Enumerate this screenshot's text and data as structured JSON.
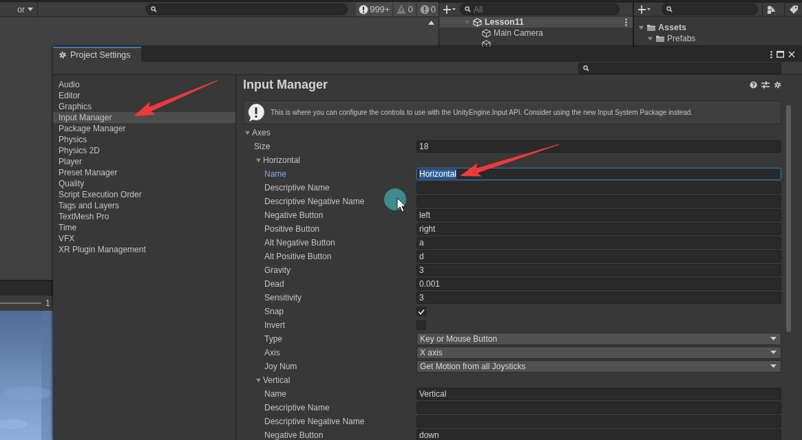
{
  "console_toolbar": {
    "dropdown": "or",
    "counts": [
      {
        "kind": "log",
        "value": "999+"
      },
      {
        "kind": "warning",
        "value": "0"
      },
      {
        "kind": "error",
        "value": "0"
      }
    ]
  },
  "game_view": {
    "scale": "1"
  },
  "hierarchy": {
    "search_placeholder": "All",
    "scene": "Lesson11",
    "objects": [
      "Main Camera"
    ]
  },
  "project": {
    "folders": [
      {
        "name": "Assets",
        "expanded": true,
        "children": [
          {
            "name": "Prefabs",
            "expanded": true
          }
        ]
      }
    ]
  },
  "window": {
    "title": "Project Settings",
    "sidebar": {
      "items": [
        {
          "label": "Audio",
          "selected": false
        },
        {
          "label": "Editor",
          "selected": false
        },
        {
          "label": "Graphics",
          "selected": false
        },
        {
          "label": "Input Manager",
          "selected": true
        },
        {
          "label": "Package Manager",
          "selected": false
        },
        {
          "label": "Physics",
          "selected": false
        },
        {
          "label": "Physics 2D",
          "selected": false
        },
        {
          "label": "Player",
          "selected": false
        },
        {
          "label": "Preset Manager",
          "selected": false
        },
        {
          "label": "Quality",
          "selected": false
        },
        {
          "label": "Script Execution Order",
          "selected": false
        },
        {
          "label": "Tags and Layers",
          "selected": false
        },
        {
          "label": "TextMesh Pro",
          "selected": false
        },
        {
          "label": "Time",
          "selected": false
        },
        {
          "label": "VFX",
          "selected": false
        },
        {
          "label": "XR Plugin Management",
          "selected": false
        }
      ]
    },
    "page_title": "Input Manager",
    "info": "This is where you can configure the controls to use with the UnityEngine.Input API. Consider using the new Input System Package instead.",
    "axes": {
      "label": "Axes",
      "expanded": true,
      "size_label": "Size",
      "size": "18",
      "children": [
        {
          "label": "Horizontal",
          "expanded": true,
          "properties": [
            {
              "label": "Name",
              "kind": "text",
              "value": "Horizontal",
              "focused": true
            },
            {
              "label": "Descriptive Name",
              "kind": "text",
              "focused": false
            },
            {
              "label": "Descriptive Negative Name",
              "kind": "text",
              "focused": false
            },
            {
              "label": "Negative Button",
              "kind": "text",
              "value": "left",
              "focused": false
            },
            {
              "label": "Positive Button",
              "kind": "text",
              "value": "right",
              "focused": false
            },
            {
              "label": "Alt Negative Button",
              "kind": "text",
              "value": "a",
              "focused": false
            },
            {
              "label": "Alt Positive Button",
              "kind": "text",
              "value": "d",
              "focused": false
            },
            {
              "label": "Gravity",
              "kind": "text",
              "value": "3",
              "focused": false
            },
            {
              "label": "Dead",
              "kind": "text",
              "value": "0.001",
              "focused": false
            },
            {
              "label": "Sensitivity",
              "kind": "text",
              "value": "3",
              "focused": false
            },
            {
              "label": "Snap",
              "kind": "checkbox",
              "checked": true
            },
            {
              "label": "Invert",
              "kind": "checkbox",
              "checked": false
            },
            {
              "label": "Type",
              "kind": "dropdown",
              "value": "Key or Mouse Button"
            },
            {
              "label": "Axis",
              "kind": "dropdown",
              "value": "X axis"
            },
            {
              "label": "Joy Num",
              "kind": "dropdown",
              "value": "Get Motion from all Joysticks"
            }
          ]
        },
        {
          "label": "Vertical",
          "expanded": true,
          "properties": [
            {
              "label": "Name",
              "kind": "text",
              "value": "Vertical",
              "focused": false
            },
            {
              "label": "Descriptive Name",
              "kind": "text",
              "focused": false
            },
            {
              "label": "Descriptive Negative Name",
              "kind": "text",
              "focused": false
            },
            {
              "label": "Negative Button",
              "kind": "text",
              "value": "down",
              "focused": false
            }
          ]
        }
      ]
    }
  }
}
